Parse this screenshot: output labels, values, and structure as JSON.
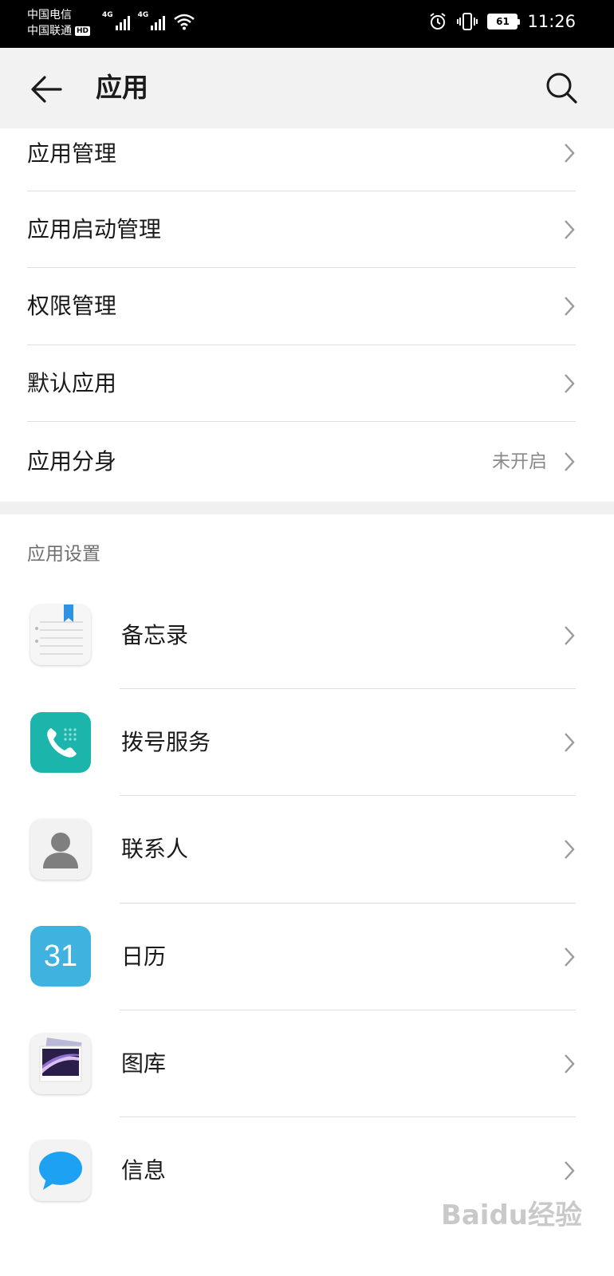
{
  "status_bar": {
    "carrier1": "中国电信",
    "carrier2": "中国联通",
    "hd_badge": "HD",
    "network1": "4G",
    "network2": "4G",
    "battery": "61",
    "time": "11:26"
  },
  "header": {
    "title": "应用",
    "back_icon": "back-arrow-icon",
    "search_icon": "search-icon"
  },
  "menu": {
    "app_management": "应用管理",
    "startup_management": "应用启动管理",
    "permission_management": "权限管理",
    "default_apps": "默认应用",
    "app_twin": "应用分身",
    "app_twin_status": "未开启"
  },
  "app_settings": {
    "header": "应用设置",
    "apps": [
      {
        "label": "备忘录",
        "icon": "notepad-icon"
      },
      {
        "label": "拨号服务",
        "icon": "phone-icon"
      },
      {
        "label": "联系人",
        "icon": "contacts-icon"
      },
      {
        "label": "日历",
        "icon": "calendar-icon",
        "icon_text": "31"
      },
      {
        "label": "图库",
        "icon": "gallery-icon"
      },
      {
        "label": "信息",
        "icon": "message-icon"
      }
    ]
  },
  "watermark": "Baidu经验",
  "colors": {
    "header_bg": "#f2f2f2",
    "divider": "#dedede",
    "phone_teal": "#1cb5ac",
    "calendar_blue": "#3fb2e0",
    "message_blue": "#1da1f2"
  }
}
